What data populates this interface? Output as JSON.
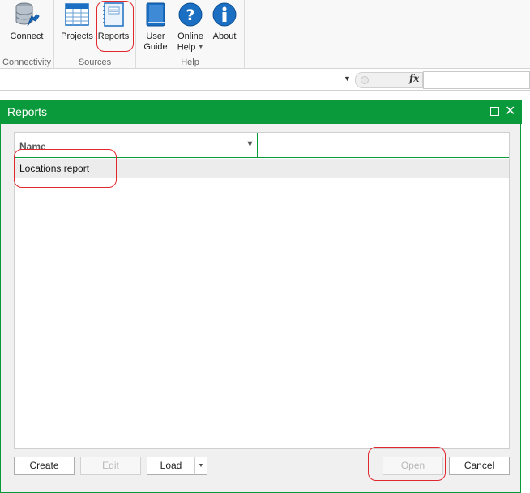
{
  "ribbon": {
    "groups": [
      {
        "label": "Connectivity",
        "buttons": [
          {
            "label": "Connect",
            "icon": "database-connect-icon"
          }
        ]
      },
      {
        "label": "Sources",
        "buttons": [
          {
            "label": "Projects",
            "icon": "table-icon"
          },
          {
            "label": "Reports",
            "icon": "notebook-icon"
          }
        ]
      },
      {
        "label": "Help",
        "buttons": [
          {
            "label": "User",
            "label2": "Guide",
            "icon": "book-icon"
          },
          {
            "label": "Online",
            "label2": "Help",
            "icon": "question-icon",
            "dropdown": true
          },
          {
            "label": "About",
            "icon": "info-icon"
          }
        ]
      }
    ]
  },
  "formula_bar": {
    "fx_label": "fx",
    "value": ""
  },
  "reports_panel": {
    "title": "Reports",
    "grid": {
      "columns": [
        "Name",
        ""
      ],
      "rows": [
        {
          "name": "Locations report"
        }
      ]
    },
    "buttons": {
      "create": "Create",
      "edit": "Edit",
      "load": "Load",
      "open": "Open",
      "cancel": "Cancel"
    }
  },
  "colors": {
    "accent_green": "#0a9a3b",
    "annotation_red": "#e0282e",
    "icon_blue": "#1b6fc2"
  }
}
